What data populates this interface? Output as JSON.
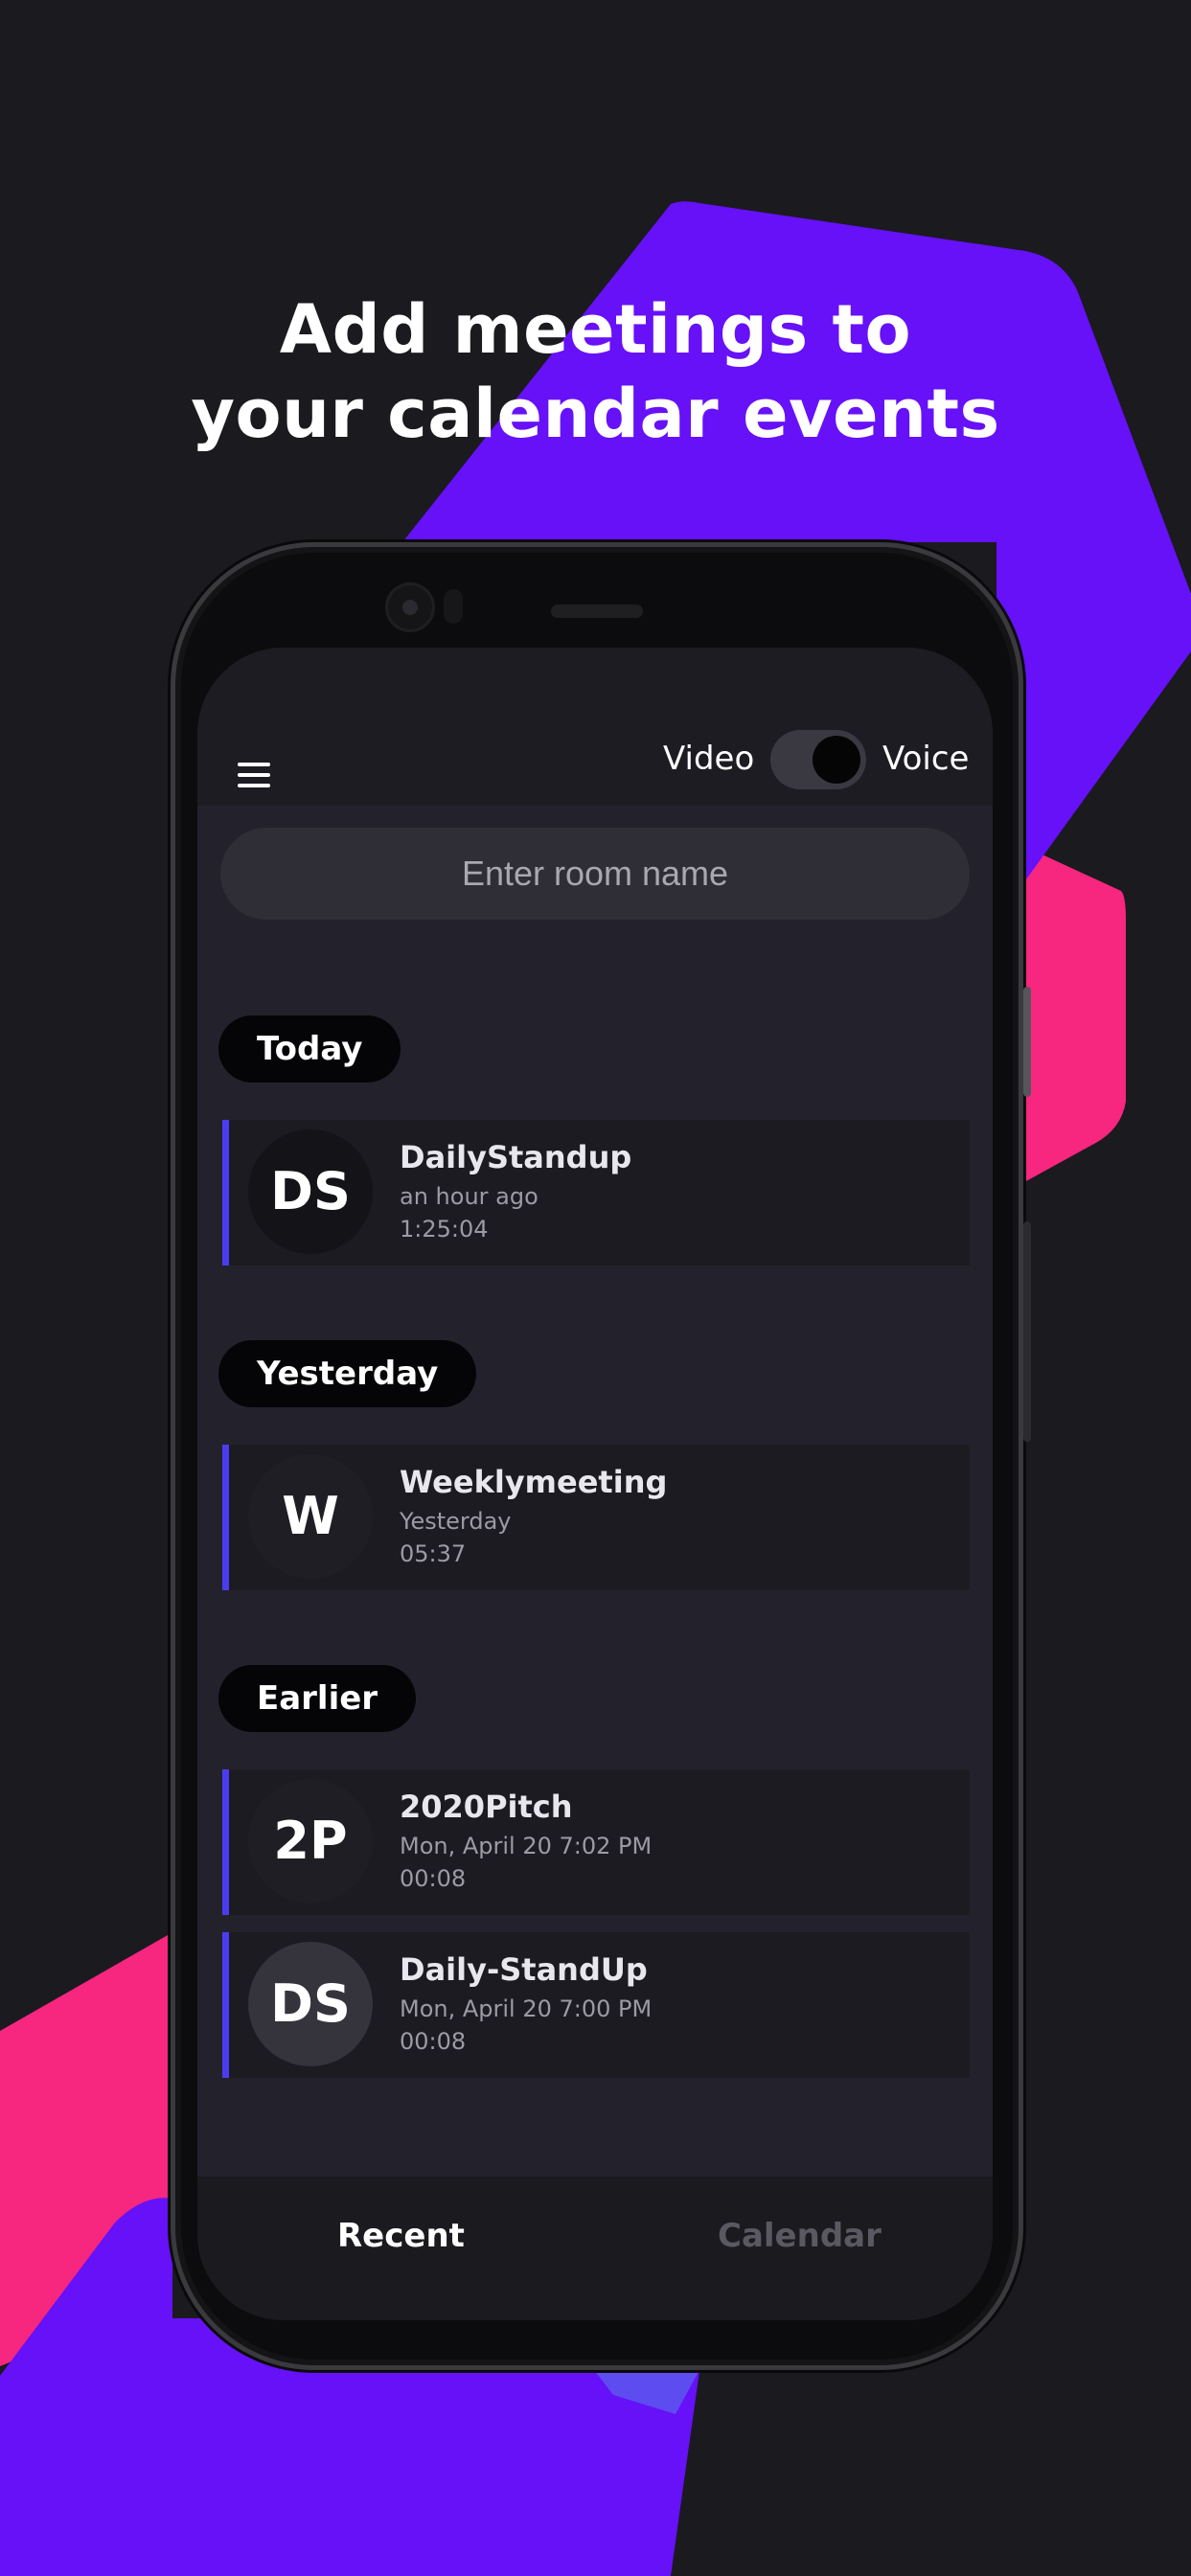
{
  "headline": {
    "line1": "Add meetings to",
    "line2": "your calendar events"
  },
  "colors": {
    "accent_purple": "#6611f7",
    "accent_pink": "#f7267f",
    "background": "#1b1a1f",
    "card_accent": "#4a3df0"
  },
  "app": {
    "menu_icon": "hamburger-menu-icon",
    "toggle": {
      "left_label": "Video",
      "right_label": "Voice"
    },
    "search": {
      "placeholder": "Enter room name",
      "value": ""
    },
    "sections": [
      {
        "label": "Today",
        "meetings": [
          {
            "initials": "DS",
            "title": "DailyStandup",
            "subtitle": "an hour ago",
            "duration": "1:25:04"
          }
        ]
      },
      {
        "label": "Yesterday",
        "meetings": [
          {
            "initials": "W",
            "title": "Weeklymeeting",
            "subtitle": "Yesterday",
            "duration": "05:37"
          }
        ]
      },
      {
        "label": "Earlier",
        "meetings": [
          {
            "initials": "2P",
            "title": "2020Pitch",
            "subtitle": "Mon, April 20 7:02 PM",
            "duration": "00:08"
          },
          {
            "initials": "DS",
            "title": "Daily-StandUp",
            "subtitle": "Mon, April 20 7:00 PM",
            "duration": "00:08"
          }
        ]
      }
    ],
    "bottom_nav": {
      "recent": "Recent",
      "calendar": "Calendar"
    }
  }
}
